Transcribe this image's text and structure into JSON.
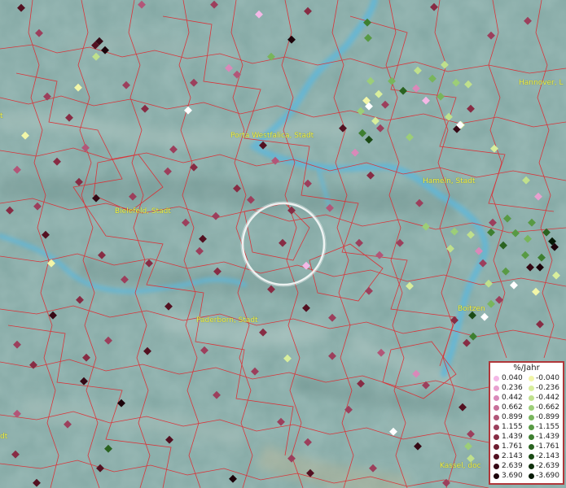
{
  "legend": {
    "title": "%/Jahr",
    "rows": [
      {
        "pos": "0.040",
        "pos_color": "#f4b8e6",
        "neg": "-0.040",
        "neg_color": "#f2f6a8"
      },
      {
        "pos": "0.236",
        "pos_color": "#e8a0cf",
        "neg": "-0.236",
        "neg_color": "#d8ee9c"
      },
      {
        "pos": "0.442",
        "pos_color": "#d989b9",
        "neg": "-0.442",
        "neg_color": "#bfe08c"
      },
      {
        "pos": "0.662",
        "pos_color": "#c87099",
        "neg": "-0.662",
        "neg_color": "#9cce78"
      },
      {
        "pos": "0.899",
        "pos_color": "#b25678",
        "neg": "-0.899",
        "neg_color": "#78b55c"
      },
      {
        "pos": "1.155",
        "pos_color": "#9c3f5c",
        "neg": "-1.155",
        "neg_color": "#589a44"
      },
      {
        "pos": "1.439",
        "pos_color": "#872c44",
        "neg": "-1.439",
        "neg_color": "#3e7f30"
      },
      {
        "pos": "1.761",
        "pos_color": "#6e1d30",
        "neg": "-1.761",
        "neg_color": "#2a6320"
      },
      {
        "pos": "2.143",
        "pos_color": "#531121",
        "neg": "-2.143",
        "neg_color": "#1b4a15"
      },
      {
        "pos": "2.639",
        "pos_color": "#360915",
        "neg": "-2.639",
        "neg_color": "#10300d"
      },
      {
        "pos": "3.690",
        "pos_color": "#1c030a",
        "neg": "-3.690",
        "neg_color": "#071a06"
      }
    ]
  },
  "cities": [
    {
      "name": "Porta Westfalica, Stadt"
    },
    {
      "name": "Hannover, L"
    },
    {
      "name": "Hameln, Stadt"
    },
    {
      "name": "Bielefeld, Stadt"
    },
    {
      "name": "Paderborn, Stadt"
    },
    {
      "name": "Boitzen"
    },
    {
      "name": "Kassel, doc"
    },
    {
      "name": "dt"
    },
    {
      "name": "t"
    }
  ],
  "colors": {
    "boundary": "#e0282e",
    "river": "#3f9fc8",
    "label": "#f2f24a",
    "terrain": "#7fa3a0"
  }
}
